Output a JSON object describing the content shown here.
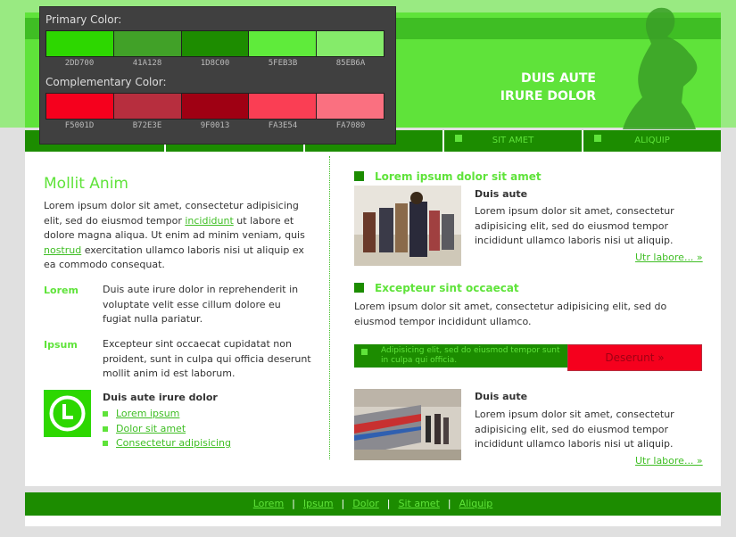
{
  "header": {
    "title_line1": "DUIS AUTE",
    "title_line2": "IRURE DOLOR"
  },
  "nav": {
    "items": [
      {
        "label": ""
      },
      {
        "label": ""
      },
      {
        "label": ""
      },
      {
        "label": "SIT AMET"
      },
      {
        "label": "ALIQUIP"
      }
    ]
  },
  "left": {
    "title": "Mollit Anim",
    "intro": {
      "p1": "Lorem ipsum dolor sit amet, consectetur adipisicing elit, sed do eiusmod tempor",
      "link1": "incididunt",
      "p2": "ut labore et dolore magna aliqua. Ut enim ad minim veniam, quis",
      "link2": "nostrud",
      "p3": "exercitation ullamco laboris nisi ut aliquip ex ea commodo consequat."
    },
    "terms": [
      {
        "term": "Lorem",
        "text": "Duis aute irure dolor in reprehenderit in voluptate velit esse cillum dolore eu fugiat nulla pariatur."
      },
      {
        "term": "Ipsum",
        "text": "Excepteur sint occaecat cupidatat non proident, sunt in culpa qui officia deserunt mollit anim id est laborum."
      }
    ],
    "box": {
      "title": "Duis aute irure dolor",
      "links": [
        "Lorem ipsum",
        "Dolor sit amet",
        "Consectetur adipisicing"
      ]
    }
  },
  "right": {
    "section1": {
      "heading": "Lorem ipsum dolor sit amet",
      "sub_title": "Duis aute",
      "text": "Lorem ipsum dolor sit amet, consectetur adipisicing elit, sed do eiusmod tempor incididunt ullamco laboris nisi ut aliquip.",
      "more": "Utr labore... »"
    },
    "section2": {
      "heading": "Excepteur sint occaecat",
      "text": "Lorem ipsum dolor sit amet, consectetur adipisicing elit, sed do eiusmod tempor incididunt ullamco."
    },
    "note": "Adipisicing elit, sed do eiusmod tempor sunt in culpa qui officia.",
    "button": "Deserunt »",
    "section3": {
      "sub_title": "Duis aute",
      "text": "Lorem ipsum dolor sit amet, consectetur adipisicing elit, sed do eiusmod tempor incididunt ullamco laboris nisi ut aliquip.",
      "more": "Utr labore... »"
    }
  },
  "footer": {
    "links": [
      "Lorem",
      "Ipsum",
      "Dolor",
      "Sit amet",
      "Aliquip"
    ],
    "separator": "|"
  },
  "palette": {
    "primary_label": "Primary Color:",
    "primary": [
      "2DD700",
      "41A128",
      "1D8C00",
      "5FEB3B",
      "85EB6A"
    ],
    "primary_colors": [
      "#2dd700",
      "#41a128",
      "#1d8c00",
      "#5feb3b",
      "#85eb6a"
    ],
    "complementary_label": "Complementary Color:",
    "complementary": [
      "F5001D",
      "B72E3E",
      "9F0013",
      "FA3E54",
      "FA7080"
    ],
    "complementary_colors": [
      "#f5001d",
      "#b72e3e",
      "#9f0013",
      "#fa3e54",
      "#fa7080"
    ]
  }
}
